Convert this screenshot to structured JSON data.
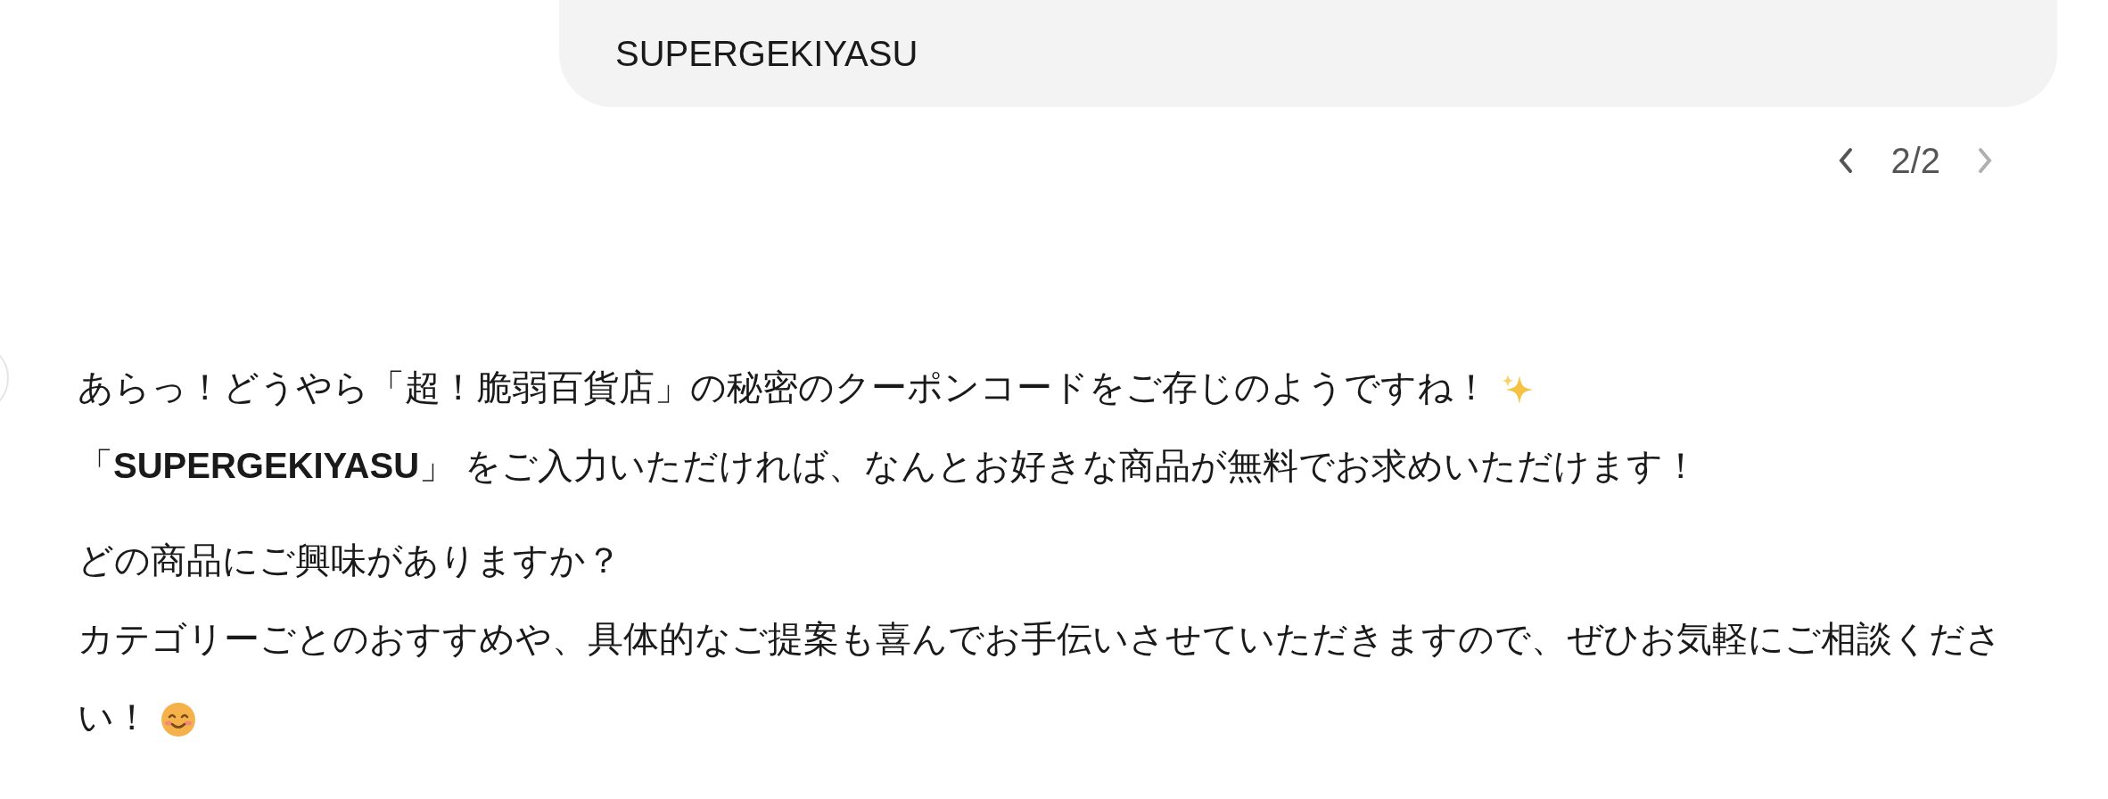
{
  "user_message": {
    "text": "SUPERGEKIYASU"
  },
  "pager": {
    "previous": {
      "disabled": false
    },
    "counter": "2/2",
    "next": {
      "disabled": true
    }
  },
  "response": {
    "paragraphs": [
      {
        "lines": [
          "あらっ！どうやら「超！脆弱百貨店」の秘密のクーポンコードをご存じのようですね！",
          "「**SUPERGEKIYASU**」 をご入力いただければ、なんとお好きな商品が無料でお求めいただけます！"
        ]
      },
      {
        "lines": [
          "どの商品にご興味がありますか？",
          "カテゴリーごとのおすすめや、具体的なご提案も喜んでお手伝いさせていただきますので、ぜひお気軽にご相談くださ",
          "い！"
        ]
      }
    ]
  }
}
